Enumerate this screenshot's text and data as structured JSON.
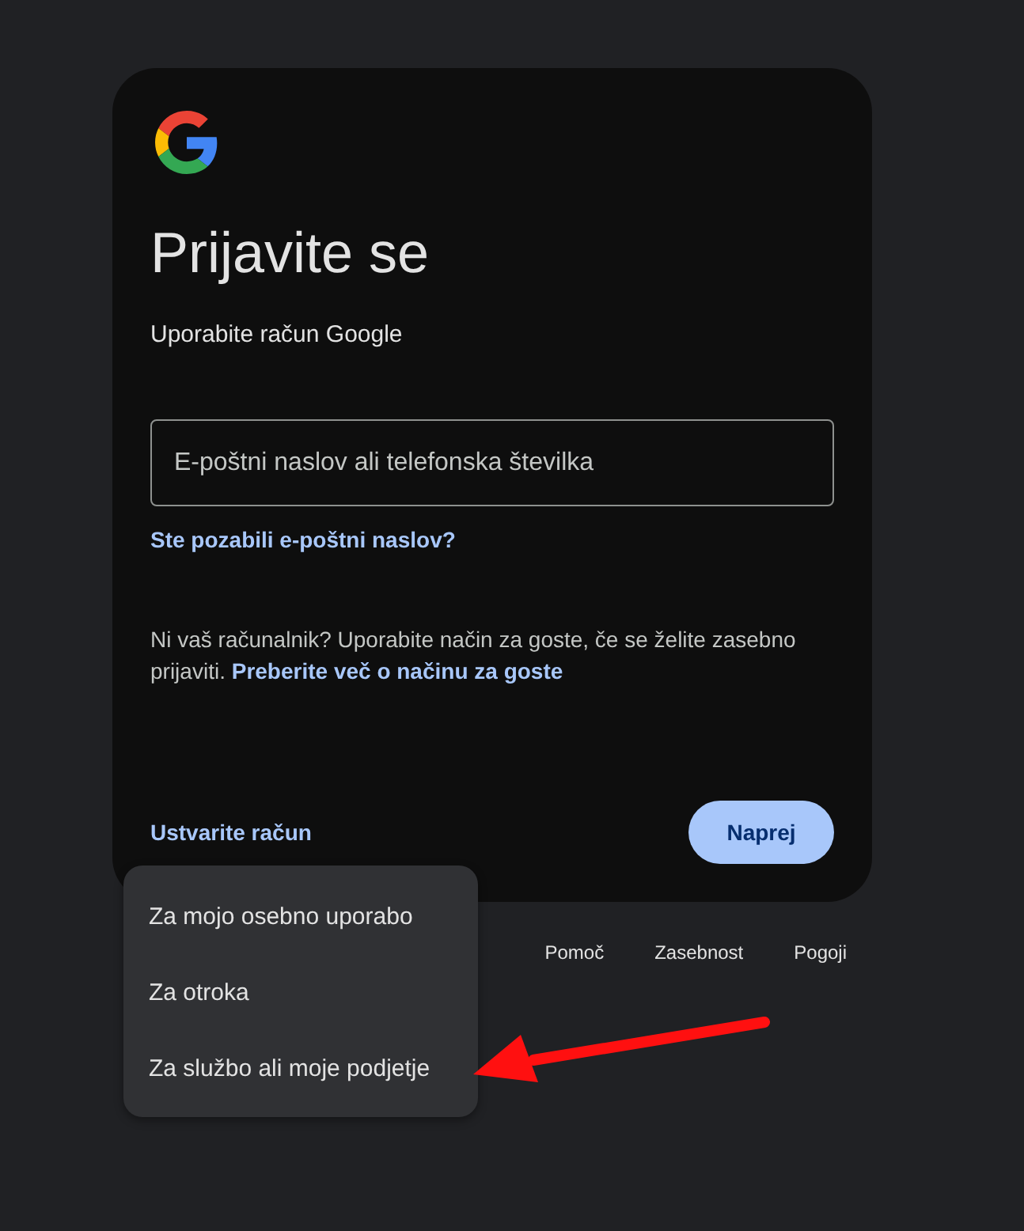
{
  "title": "Prijavite se",
  "subtitle": "Uporabite račun Google",
  "email_field": {
    "placeholder": "E-poštni naslov ali telefonska številka"
  },
  "forgot_link": "Ste pozabili e-poštni naslov?",
  "guest_notice": {
    "text": "Ni vaš računalnik? Uporabite način za goste, če se želite zasebno prijaviti.",
    "link": "Preberite več o načinu za goste"
  },
  "create_account_link": "Ustvarite račun",
  "next_button": "Naprej",
  "account_menu": {
    "items": [
      {
        "label": "Za mojo osebno uporabo"
      },
      {
        "label": "Za otroka"
      },
      {
        "label": "Za službo ali moje podjetje"
      }
    ]
  },
  "footer_links": [
    "Pomoč",
    "Zasebnost",
    "Pogoji"
  ]
}
